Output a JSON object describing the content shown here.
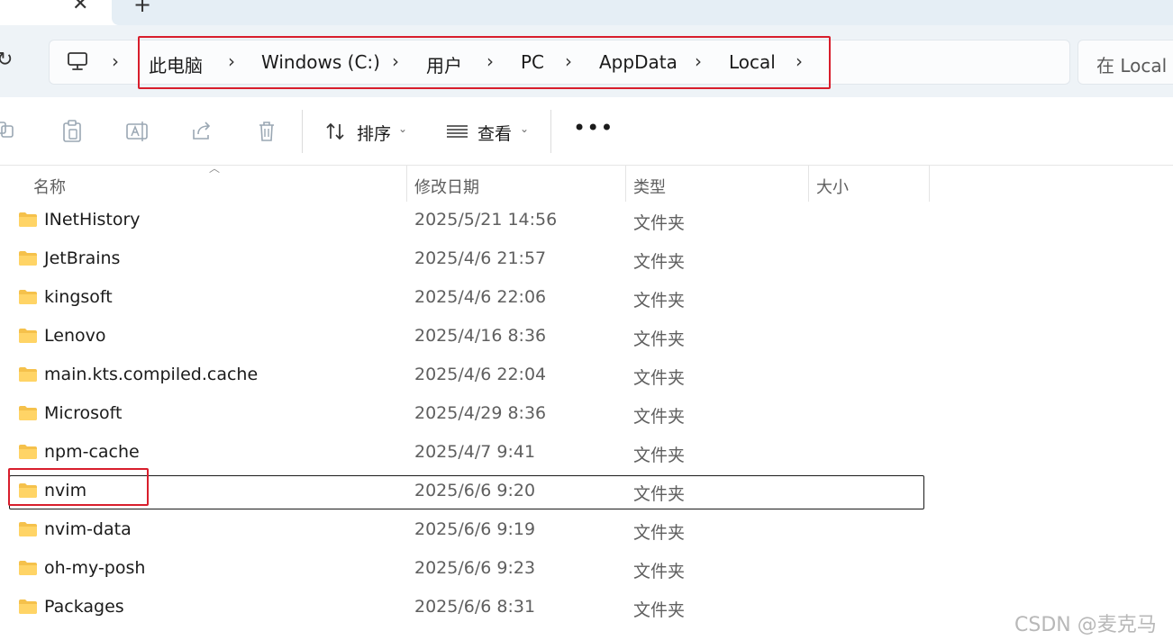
{
  "tabs": {
    "close_glyph": "✕",
    "new_glyph": "+"
  },
  "address": {
    "crumbs": [
      "此电脑",
      "Windows (C:)",
      "用户",
      "PC",
      "AppData",
      "Local"
    ],
    "search_placeholder": "在 Local 中"
  },
  "toolbar": {
    "sort_label": "排序",
    "view_label": "查看",
    "more_glyph": "•••"
  },
  "columns": {
    "name": "名称",
    "modified": "修改日期",
    "type": "类型",
    "size": "大小"
  },
  "rows": [
    {
      "name": "INetHistory",
      "date": "2025/5/21 14:56",
      "type": "文件夹"
    },
    {
      "name": "JetBrains",
      "date": "2025/4/6 21:57",
      "type": "文件夹"
    },
    {
      "name": "kingsoft",
      "date": "2025/4/6 22:06",
      "type": "文件夹"
    },
    {
      "name": "Lenovo",
      "date": "2025/4/16 8:36",
      "type": "文件夹"
    },
    {
      "name": "main.kts.compiled.cache",
      "date": "2025/4/6 22:04",
      "type": "文件夹"
    },
    {
      "name": "Microsoft",
      "date": "2025/4/29 8:36",
      "type": "文件夹"
    },
    {
      "name": "npm-cache",
      "date": "2025/4/7 9:41",
      "type": "文件夹"
    },
    {
      "name": "nvim",
      "date": "2025/6/6 9:20",
      "type": "文件夹"
    },
    {
      "name": "nvim-data",
      "date": "2025/6/6 9:19",
      "type": "文件夹"
    },
    {
      "name": "oh-my-posh",
      "date": "2025/6/6 9:23",
      "type": "文件夹"
    },
    {
      "name": "Packages",
      "date": "2025/6/6 8:31",
      "type": "文件夹"
    }
  ],
  "watermark": "CSDN @麦克马",
  "colors": {
    "folder": "#f5c14b",
    "highlight": "#d81e2c",
    "nav_bg": "#eef3f7"
  }
}
